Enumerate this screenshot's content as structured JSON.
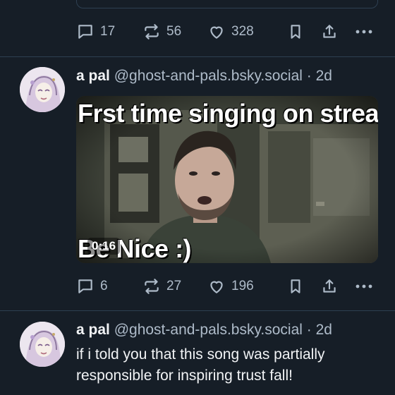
{
  "post_prev": {
    "stats": {
      "replies": "17",
      "reposts": "56",
      "likes": "328"
    }
  },
  "post_video": {
    "author_name": "a pal",
    "author_handle": "@ghost-and-pals.bsky.social",
    "time": "· 2d",
    "video": {
      "caption_top": "Frst time singing on stream",
      "caption_bottom": "Be Nice :)",
      "duration": "0:16"
    },
    "stats": {
      "replies": "6",
      "reposts": "27",
      "likes": "196"
    }
  },
  "post_next": {
    "author_name": "a pal",
    "author_handle": "@ghost-and-pals.bsky.social",
    "time": "· 2d",
    "text_line1": "if i told you that this song was partially",
    "text_line2": "responsible for inspiring trust fall!"
  },
  "icons": [
    "reply-icon",
    "repost-icon",
    "like-icon",
    "bookmark-icon",
    "share-icon",
    "more-icon"
  ],
  "colors": {
    "background": "#161e27",
    "divider": "#2e4052",
    "muted": "#aebbc9",
    "text": "#f1f3f5"
  }
}
